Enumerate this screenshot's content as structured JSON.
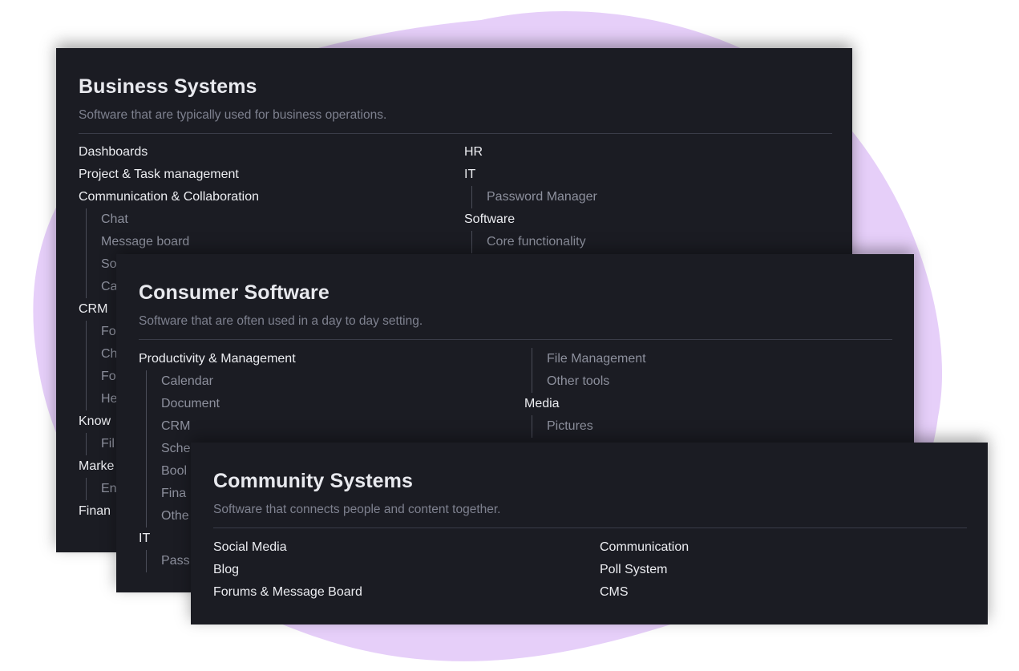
{
  "colors": {
    "blob": "#e6cff9",
    "card_bg": "#1b1c23",
    "title": "#e8e9ee",
    "subtitle": "#7e818f",
    "divider": "#3a3c48",
    "item_top": "#ecedf1",
    "item_sub": "#8d909d"
  },
  "business": {
    "title": "Business Systems",
    "subtitle": "Software that are typically used for business operations.",
    "left_col": [
      {
        "label": "Dashboards"
      },
      {
        "label": "Project & Task management"
      },
      {
        "label": "Communication & Collaboration"
      },
      {
        "label": "Chat",
        "sub": true
      },
      {
        "label": "Message board",
        "sub": true
      },
      {
        "label": "So",
        "sub": true
      },
      {
        "label": "Ca",
        "sub": true
      },
      {
        "label": "CRM"
      },
      {
        "label": "Fo",
        "sub": true
      },
      {
        "label": "Ch",
        "sub": true
      },
      {
        "label": "Fo",
        "sub": true
      },
      {
        "label": "He",
        "sub": true
      },
      {
        "label": "Know"
      },
      {
        "label": "Fil",
        "sub": true
      },
      {
        "label": "Marke"
      },
      {
        "label": "En",
        "sub": true
      },
      {
        "label": "Finan"
      }
    ],
    "right_col": [
      {
        "label": "HR"
      },
      {
        "label": "IT"
      },
      {
        "label": "Password Manager",
        "sub": true
      },
      {
        "label": "Software"
      },
      {
        "label": "Core functionality",
        "sub": true
      }
    ]
  },
  "consumer": {
    "title": "Consumer Software",
    "subtitle": "Software that are often used in a day to day setting.",
    "left_col": [
      {
        "label": "Productivity & Management"
      },
      {
        "label": "Calendar",
        "sub": true
      },
      {
        "label": "Document",
        "sub": true
      },
      {
        "label": "CRM",
        "sub": true
      },
      {
        "label": "Sche",
        "sub": true
      },
      {
        "label": "Bool",
        "sub": true
      },
      {
        "label": "Fina",
        "sub": true
      },
      {
        "label": "Othe",
        "sub": true
      },
      {
        "label": "IT"
      },
      {
        "label": "Pass",
        "sub": true
      }
    ],
    "right_col": [
      {
        "label": "File Management",
        "sub": true
      },
      {
        "label": "Other tools",
        "sub": true
      },
      {
        "label": "Media"
      },
      {
        "label": "Pictures",
        "sub": true
      }
    ]
  },
  "community": {
    "title": "Community Systems",
    "subtitle": "Software that connects people and content together.",
    "left_col": [
      {
        "label": "Social Media"
      },
      {
        "label": "Blog"
      },
      {
        "label": "Forums & Message Board"
      }
    ],
    "right_col": [
      {
        "label": "Communication"
      },
      {
        "label": "Poll System"
      },
      {
        "label": "CMS"
      }
    ]
  }
}
